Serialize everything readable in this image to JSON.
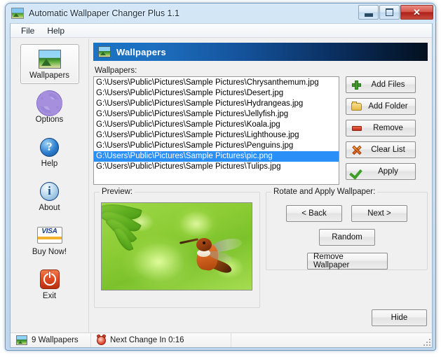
{
  "window": {
    "title": "Automatic Wallpaper Changer Plus 1.1",
    "title_icon": "picture-icon",
    "controls": {
      "minimize": "minimize-icon",
      "maximize": "maximize-icon",
      "close": "✕"
    }
  },
  "menu": {
    "items": [
      {
        "label": "File"
      },
      {
        "label": "Help"
      }
    ]
  },
  "sidebar": {
    "items": [
      {
        "label": "Wallpapers",
        "icon": "picture-icon",
        "selected": true
      },
      {
        "label": "Options",
        "icon": "gear-icon",
        "selected": false
      },
      {
        "label": "Help",
        "icon": "question-circle-icon",
        "selected": false
      },
      {
        "label": "About",
        "icon": "info-icon",
        "selected": false
      },
      {
        "label": "Buy Now!",
        "icon": "visa-card-icon",
        "selected": false
      },
      {
        "label": "Exit",
        "icon": "power-icon",
        "selected": false
      }
    ]
  },
  "header": {
    "title": "Wallpapers",
    "icon": "picture-icon"
  },
  "wallpapers_section": {
    "label": "Wallpapers:",
    "items": [
      {
        "path": "G:\\Users\\Public\\Pictures\\Sample Pictures\\Chrysanthemum.jpg",
        "selected": false
      },
      {
        "path": "G:\\Users\\Public\\Pictures\\Sample Pictures\\Desert.jpg",
        "selected": false
      },
      {
        "path": "G:\\Users\\Public\\Pictures\\Sample Pictures\\Hydrangeas.jpg",
        "selected": false
      },
      {
        "path": "G:\\Users\\Public\\Pictures\\Sample Pictures\\Jellyfish.jpg",
        "selected": false
      },
      {
        "path": "G:\\Users\\Public\\Pictures\\Sample Pictures\\Koala.jpg",
        "selected": false
      },
      {
        "path": "G:\\Users\\Public\\Pictures\\Sample Pictures\\Lighthouse.jpg",
        "selected": false
      },
      {
        "path": "G:\\Users\\Public\\Pictures\\Sample Pictures\\Penguins.jpg",
        "selected": false
      },
      {
        "path": "G:\\Users\\Public\\Pictures\\Sample Pictures\\pic.png",
        "selected": true
      },
      {
        "path": "G:\\Users\\Public\\Pictures\\Sample Pictures\\Tulips.jpg",
        "selected": false
      }
    ],
    "selection_color": "#2a8ff7"
  },
  "list_buttons": [
    {
      "label": "Add Files",
      "accel": "A",
      "icon": "plus-icon"
    },
    {
      "label": "Add Folder",
      "accel": "F",
      "icon": "folder-icon"
    },
    {
      "label": "Remove",
      "accel": "R",
      "icon": "minus-icon"
    },
    {
      "label": "Clear List",
      "accel": "L",
      "icon": "x-cross-icon"
    },
    {
      "label": "Apply",
      "accel": "A",
      "icon": "checkmark-icon"
    }
  ],
  "preview": {
    "label": "Preview:",
    "image_description": "hummingbird-on-green-bokeh"
  },
  "rotate": {
    "label": "Rotate and Apply Wallpaper:",
    "buttons": {
      "back": "< Back",
      "next": "Next >",
      "random": "Random",
      "remove_wallpaper": "Remove Wallpaper"
    }
  },
  "hide_button": {
    "label": "Hide"
  },
  "status_bar": {
    "count_text": "9 Wallpapers",
    "count_icon": "picture-icon",
    "timer_text": "Next Change In 0:16",
    "timer_icon": "alarm-clock-icon",
    "third_pane": ""
  }
}
